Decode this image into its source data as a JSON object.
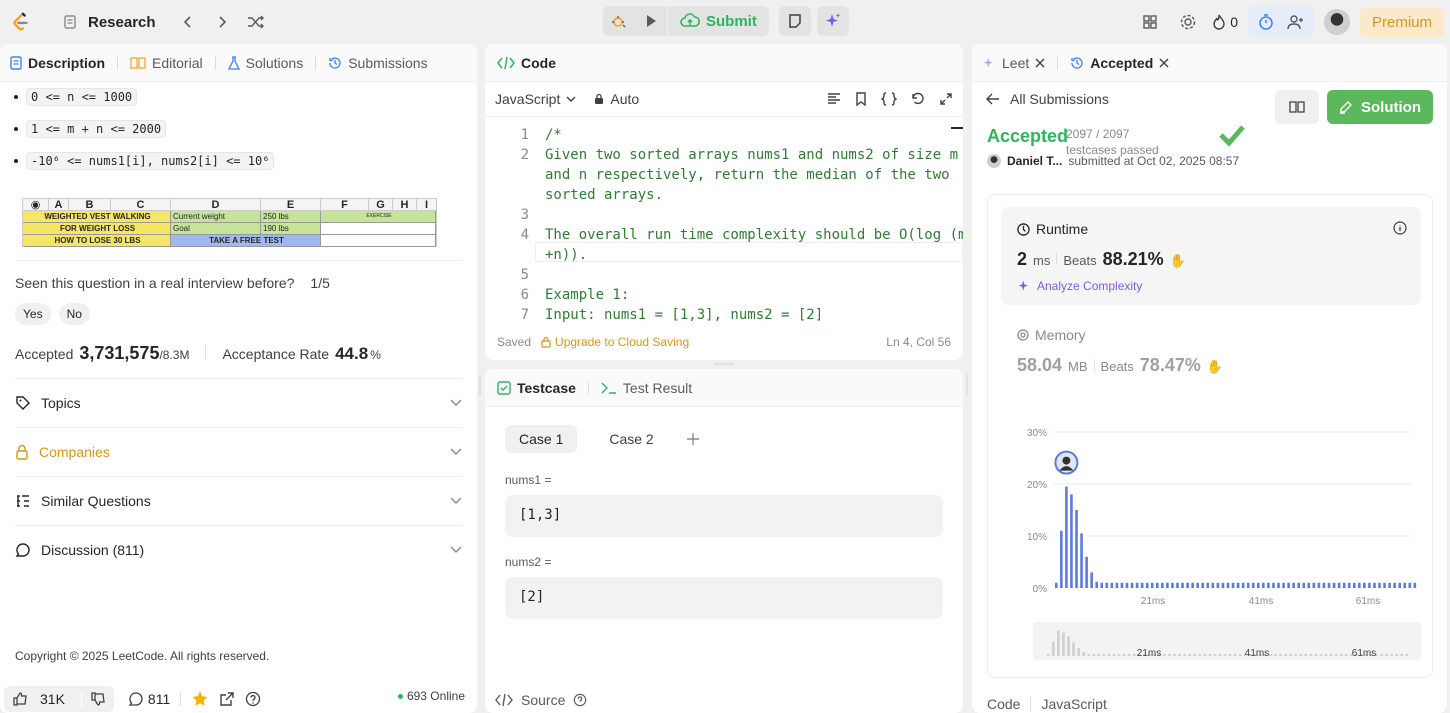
{
  "topbar": {
    "breadcrumb": "Research",
    "submit_label": "Submit",
    "streak": "0",
    "premium_label": "Premium"
  },
  "left": {
    "tabs": [
      "Description",
      "Editorial",
      "Solutions",
      "Submissions"
    ],
    "constraints": [
      "0 <= n <= 1000",
      "1 <= m + n <= 2000",
      "-10⁶ <= nums1[i], nums2[i] <= 10⁶"
    ],
    "sheet": {
      "columns": [
        "A",
        "B",
        "C",
        "D",
        "E",
        "F",
        "G",
        "H",
        "I"
      ],
      "rows": [
        [
          "WEIGHTED VEST WALKING",
          "Current weight",
          "250 lbs"
        ],
        [
          "FOR WEIGHT LOSS",
          "Goal",
          "190 lbs"
        ],
        [
          "HOW TO LOSE 30 LBS",
          "TAKE A FREE TEST",
          ""
        ]
      ],
      "side_label": "EXERCISE"
    },
    "interview_q": "Seen this question in a real interview before?",
    "interview_count": "1/5",
    "yes": "Yes",
    "no": "No",
    "accepted_label": "Accepted",
    "accepted_value": "3,731,575",
    "accepted_total": "/8.3M",
    "rate_label": "Acceptance Rate",
    "rate_value": "44.8",
    "rate_unit": "%",
    "accordions": [
      "Topics",
      "Companies",
      "Similar Questions",
      "Discussion (811)"
    ],
    "copyright": "Copyright © 2025 LeetCode. All rights reserved.",
    "likes": "31K",
    "comments": "811",
    "online": "693 Online"
  },
  "code": {
    "title": "Code",
    "language": "JavaScript",
    "mode": "Auto",
    "lines": [
      {
        "n": "1",
        "t": "/*"
      },
      {
        "n": "2",
        "t": "Given two sorted arrays nums1 and nums2 of size m"
      },
      {
        "n": "",
        "t": "and n respectively, return the median of the two"
      },
      {
        "n": "",
        "t": "sorted arrays."
      },
      {
        "n": "3",
        "t": ""
      },
      {
        "n": "4",
        "t": "The overall run time complexity should be O(log (m"
      },
      {
        "n": "",
        "t": "+n))."
      },
      {
        "n": "5",
        "t": ""
      },
      {
        "n": "6",
        "t": "Example 1:"
      },
      {
        "n": "7",
        "t": "Input: nums1 = [1,3], nums2 = [2]"
      }
    ],
    "saved": "Saved",
    "upgrade": "Upgrade to Cloud Saving",
    "position": "Ln 4, Col 56"
  },
  "testcase": {
    "tab_testcase": "Testcase",
    "tab_result": "Test Result",
    "cases": [
      "Case 1",
      "Case 2"
    ],
    "fields": [
      {
        "label": "nums1 =",
        "value": "[1,3]"
      },
      {
        "label": "nums2 =",
        "value": "[2]"
      }
    ],
    "source": "Source"
  },
  "result": {
    "tab_leet": "Leet",
    "tab_accepted": "Accepted",
    "all_submissions": "All Submissions",
    "status": "Accepted",
    "testcases": "2097 / 2097 testcases passed",
    "user": "Daniel T...",
    "submitted": "submitted at Oct 02, 2025 08:57",
    "solution_label": "Solution",
    "runtime_label": "Runtime",
    "runtime_value": "2",
    "runtime_unit": "ms",
    "beats_label": "Beats",
    "runtime_beats": "88.21%",
    "analyze": "Analyze Complexity",
    "memory_label": "Memory",
    "memory_value": "58.04",
    "memory_unit": "MB",
    "memory_beats": "78.47%",
    "footer_code": "Code",
    "footer_lang": "JavaScript"
  },
  "chart_data": {
    "type": "bar",
    "y_ticks": [
      "30%",
      "20%",
      "10%",
      "0%"
    ],
    "x_ticks": [
      "21ms",
      "41ms",
      "61ms"
    ],
    "ylim": [
      0,
      30
    ],
    "values": [
      1,
      11,
      19.5,
      18,
      15,
      10.5,
      6,
      3,
      1.2,
      1,
      1,
      1,
      1,
      1,
      1,
      1,
      1,
      1,
      1,
      1,
      1,
      1,
      1,
      1,
      1,
      1,
      1,
      1,
      1,
      1,
      1,
      1,
      1,
      1,
      1,
      1,
      1,
      1,
      1,
      1,
      1,
      1,
      1,
      1,
      1,
      1,
      1,
      1,
      1,
      1,
      1,
      1,
      1,
      1,
      1,
      1,
      1,
      1,
      1,
      1,
      1,
      1,
      1,
      1,
      1,
      1,
      1,
      1,
      1,
      1,
      1,
      1
    ],
    "highlight_index": 2,
    "bar_color": "#5b7be0"
  }
}
